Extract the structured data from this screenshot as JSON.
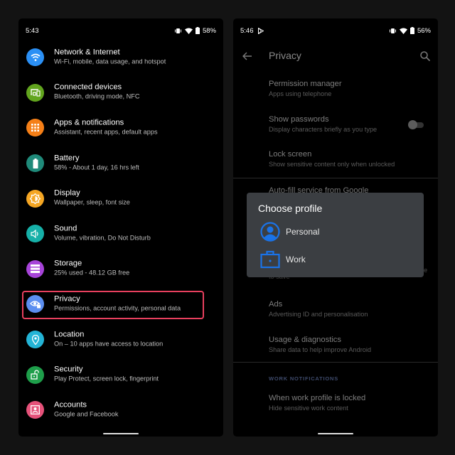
{
  "left_phone": {
    "status": {
      "time": "5:43",
      "battery": "58%"
    },
    "settings": [
      {
        "title": "Network & Internet",
        "subtitle": "Wi-Fi, mobile, data usage, and hotspot",
        "icon": "wifi-icon",
        "color": "#2b90f5"
      },
      {
        "title": "Connected devices",
        "subtitle": "Bluetooth, driving mode, NFC",
        "icon": "devices-icon",
        "color": "#62a51e"
      },
      {
        "title": "Apps & notifications",
        "subtitle": "Assistant, recent apps, default apps",
        "icon": "apps-grid-icon",
        "color": "#f57f17"
      },
      {
        "title": "Battery",
        "subtitle": "58% - About 1 day, 16 hrs left",
        "icon": "battery-icon",
        "color": "#1f8a7a"
      },
      {
        "title": "Display",
        "subtitle": "Wallpaper, sleep, font size",
        "icon": "brightness-icon",
        "color": "#f5a623"
      },
      {
        "title": "Sound",
        "subtitle": "Volume, vibration, Do Not Disturb",
        "icon": "volume-icon",
        "color": "#16b0a8"
      },
      {
        "title": "Storage",
        "subtitle": "25% used - 48.12 GB free",
        "icon": "storage-icon",
        "color": "#a744d9"
      },
      {
        "title": "Privacy",
        "subtitle": "Permissions, account activity, personal data",
        "icon": "privacy-eye-icon",
        "color": "#5b8ef0"
      },
      {
        "title": "Location",
        "subtitle": "On – 10 apps have access to location",
        "icon": "location-pin-icon",
        "color": "#23b4d6"
      },
      {
        "title": "Security",
        "subtitle": "Play Protect, screen lock, fingerprint",
        "icon": "lock-open-icon",
        "color": "#1e9e4a"
      },
      {
        "title": "Accounts",
        "subtitle": "Google and Facebook",
        "icon": "account-box-icon",
        "color": "#e6527a"
      }
    ],
    "highlight_color": "#e8405e"
  },
  "right_phone": {
    "status": {
      "time": "5:46",
      "battery": "56%"
    },
    "appbar": {
      "title": "Privacy"
    },
    "items": [
      {
        "title": "Permission manager",
        "subtitle": "Apps using telephone"
      },
      {
        "title": "Show passwords",
        "subtitle": "Display characters briefly as you type",
        "toggle": false
      },
      {
        "title": "Lock screen",
        "subtitle": "Show sensitive content only when unlocked"
      },
      {
        "title": "Auto-fill service from Google",
        "subtitle": ""
      },
      {
        "title": "",
        "subtitle": "to save"
      },
      {
        "title": "Ads",
        "subtitle": "Advertising ID and personalisation"
      },
      {
        "title": "Usage & diagnostics",
        "subtitle": "Share data to help improve Android"
      }
    ],
    "section_header": "WORK NOTIFICATIONS",
    "work_item": {
      "title": "When work profile is locked",
      "subtitle": "Hide sensitive work content"
    },
    "dialog": {
      "title": "Choose profile",
      "options": [
        {
          "label": "Personal",
          "icon": "account-circle-icon"
        },
        {
          "label": "Work",
          "icon": "briefcase-icon"
        }
      ],
      "accent": "#1a73e8"
    }
  }
}
